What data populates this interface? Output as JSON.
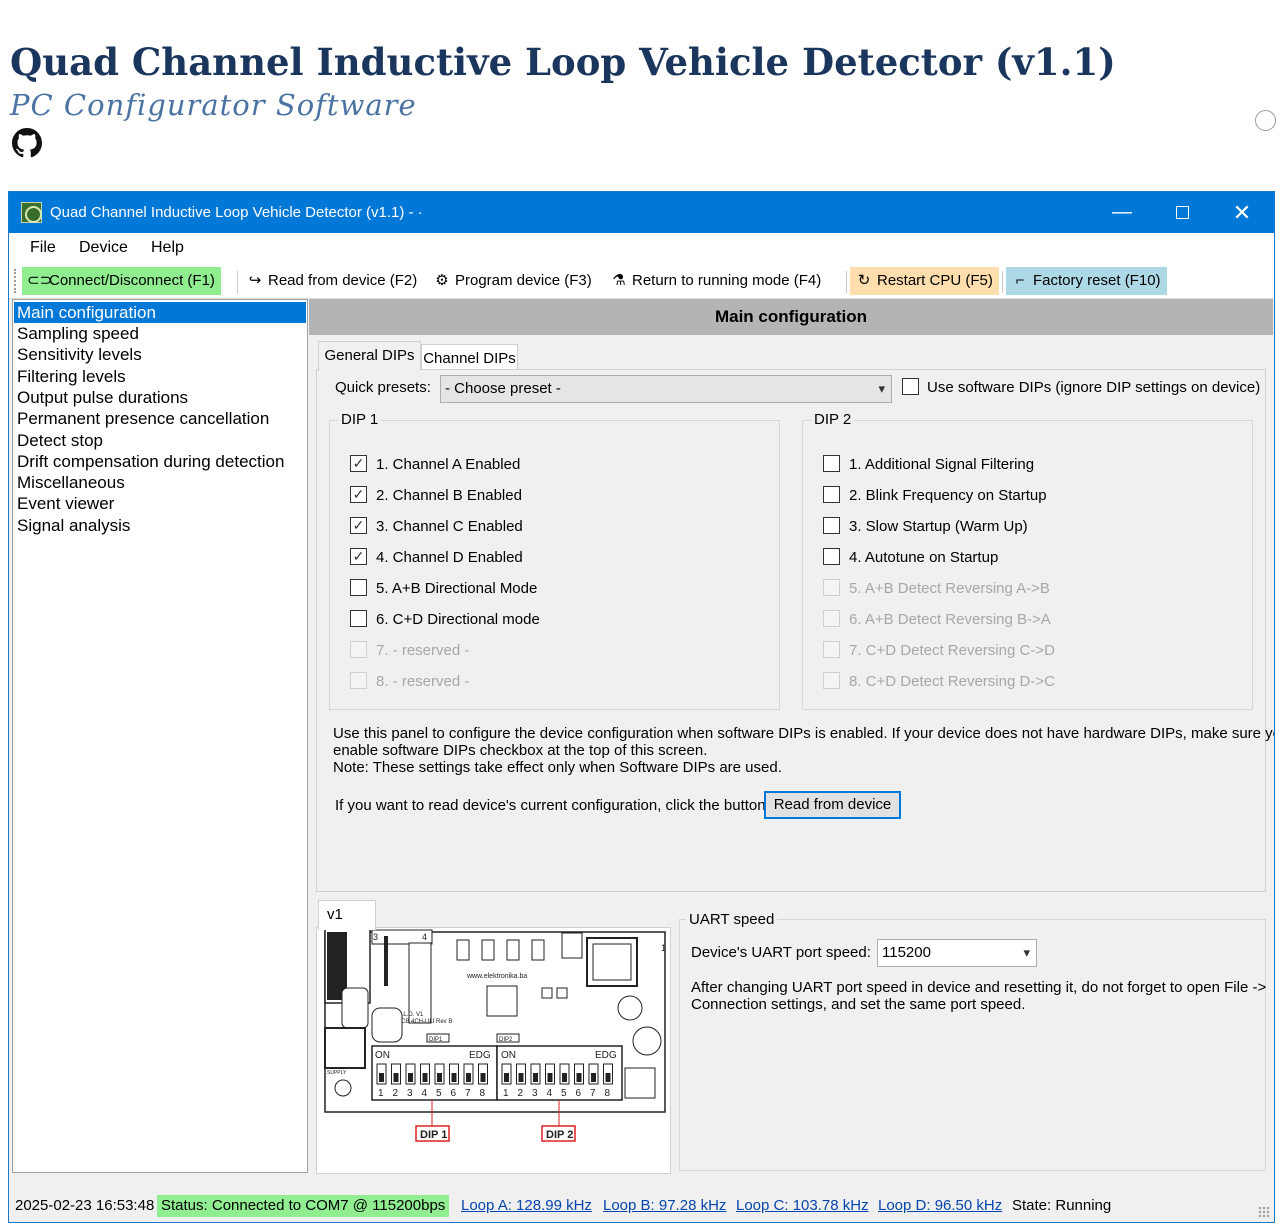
{
  "page": {
    "title": "Quad Channel Inductive Loop Vehicle Detector (v1.1)",
    "subtitle": "PC Configurator Software",
    "github_icon": "github-icon"
  },
  "window": {
    "title": "Quad Channel Inductive Loop Vehicle Detector (v1.1) - ·",
    "title_color": "#0078d7"
  },
  "menu": [
    "File",
    "Device",
    "Help"
  ],
  "toolbar": [
    {
      "label": "Connect/Disconnect (F1)",
      "icon": "⊂⊃",
      "bg": "#90ee90"
    },
    {
      "label": "Read from device (F2)",
      "icon": "↪",
      "bg": ""
    },
    {
      "label": "Program device (F3)",
      "icon": "⚙",
      "bg": ""
    },
    {
      "label": "Return to running mode (F4)",
      "icon": "⚗",
      "bg": ""
    },
    {
      "label": "Restart CPU (F5)",
      "icon": "↻",
      "bg": "#ffdead"
    },
    {
      "label": "Factory reset (F10)",
      "icon": "⌐",
      "bg": "#add8e6"
    }
  ],
  "nav": [
    "Main configuration",
    "Sampling speed",
    "Sensitivity levels",
    "Filtering levels",
    "Output pulse durations",
    "Permanent presence cancellation",
    "Detect stop",
    "Drift compensation during detection",
    "Miscellaneous",
    "Event viewer",
    "Signal analysis"
  ],
  "main_header": "Main configuration",
  "tabs": [
    "General DIPs",
    "Channel DIPs"
  ],
  "quick_presets": {
    "label": "Quick presets:",
    "value": "- Choose preset -"
  },
  "use_software_dips": {
    "label": "Use software DIPs (ignore DIP settings on device)",
    "checked": false
  },
  "dip1": {
    "label": "DIP 1",
    "items": [
      {
        "label": "1. Channel A Enabled",
        "checked": true,
        "enabled": true
      },
      {
        "label": "2. Channel B Enabled",
        "checked": true,
        "enabled": true
      },
      {
        "label": "3. Channel C Enabled",
        "checked": true,
        "enabled": true
      },
      {
        "label": "4. Channel D Enabled",
        "checked": true,
        "enabled": true
      },
      {
        "label": "5. A+B Directional Mode",
        "checked": false,
        "enabled": true
      },
      {
        "label": "6. C+D Directional mode",
        "checked": false,
        "enabled": true
      },
      {
        "label": "7. - reserved -",
        "checked": false,
        "enabled": false
      },
      {
        "label": "8. - reserved  -",
        "checked": false,
        "enabled": false
      }
    ]
  },
  "dip2": {
    "label": "DIP 2",
    "items": [
      {
        "label": "1. Additional Signal Filtering",
        "checked": false,
        "enabled": true
      },
      {
        "label": "2. Blink Frequency on Startup",
        "checked": false,
        "enabled": true
      },
      {
        "label": "3. Slow Startup (Warm Up)",
        "checked": false,
        "enabled": true
      },
      {
        "label": "4. Autotune on Startup",
        "checked": false,
        "enabled": true
      },
      {
        "label": "5. A+B Detect Reversing A->B",
        "checked": false,
        "enabled": false
      },
      {
        "label": "6. A+B Detect Reversing B->A",
        "checked": false,
        "enabled": false
      },
      {
        "label": "7. C+D Detect Reversing C->D",
        "checked": false,
        "enabled": false
      },
      {
        "label": "8. C+D Detect Reversing D->C",
        "checked": false,
        "enabled": false
      }
    ]
  },
  "info": {
    "line1": "Use this panel to configure the device configuration when software DIPs is enabled. If your device does not have hardware DIPs, make sure you",
    "line2": "enable software DIPs checkbox at the top of this screen.",
    "line3": "Note: These settings take effect only when Software DIPs are used.",
    "read_prompt": "If you want to read device's current configuration, click the button:",
    "read_button": "Read from device"
  },
  "board": {
    "tab": "v1",
    "sw_on": "ON",
    "sw_edg": "EDG",
    "sw_numbers": [
      "1",
      "2",
      "3",
      "4",
      "5",
      "6",
      "7",
      "8"
    ],
    "dip1_tag": "DIP 1",
    "dip2_tag": "DIP 2",
    "pcb_dip1": "DIP1",
    "pcb_dip2": "DIP2",
    "pcb_supply": "SUPPLY",
    "pcb_web": "www.elektronika.ba",
    "pcb_name": "Q.L.D. V1",
    "pcb_rev": "PCB 4CH-ULI Rev B",
    "pcb_conn": "3",
    "pcb_conn2": "4",
    "pcb_loop": "1"
  },
  "uart": {
    "group": "UART speed",
    "label": "Device's UART port speed:",
    "value": "115200",
    "note1": "After changing UART port speed in device and resetting it, do not forget to open File ->",
    "note2": "Connection settings, and set the same port speed."
  },
  "status": {
    "timestamp": "2025-02-23 16:53:48",
    "connection": "Status: Connected to COM7 @ 115200bps",
    "connection_bg": "#90ee90",
    "loop_a": "Loop A: 128.99 kHz",
    "loop_b": "Loop B: 97.28 kHz",
    "loop_c": "Loop C: 103.78 kHz",
    "loop_d": "Loop D: 96.50 kHz",
    "state": "State: Running"
  }
}
